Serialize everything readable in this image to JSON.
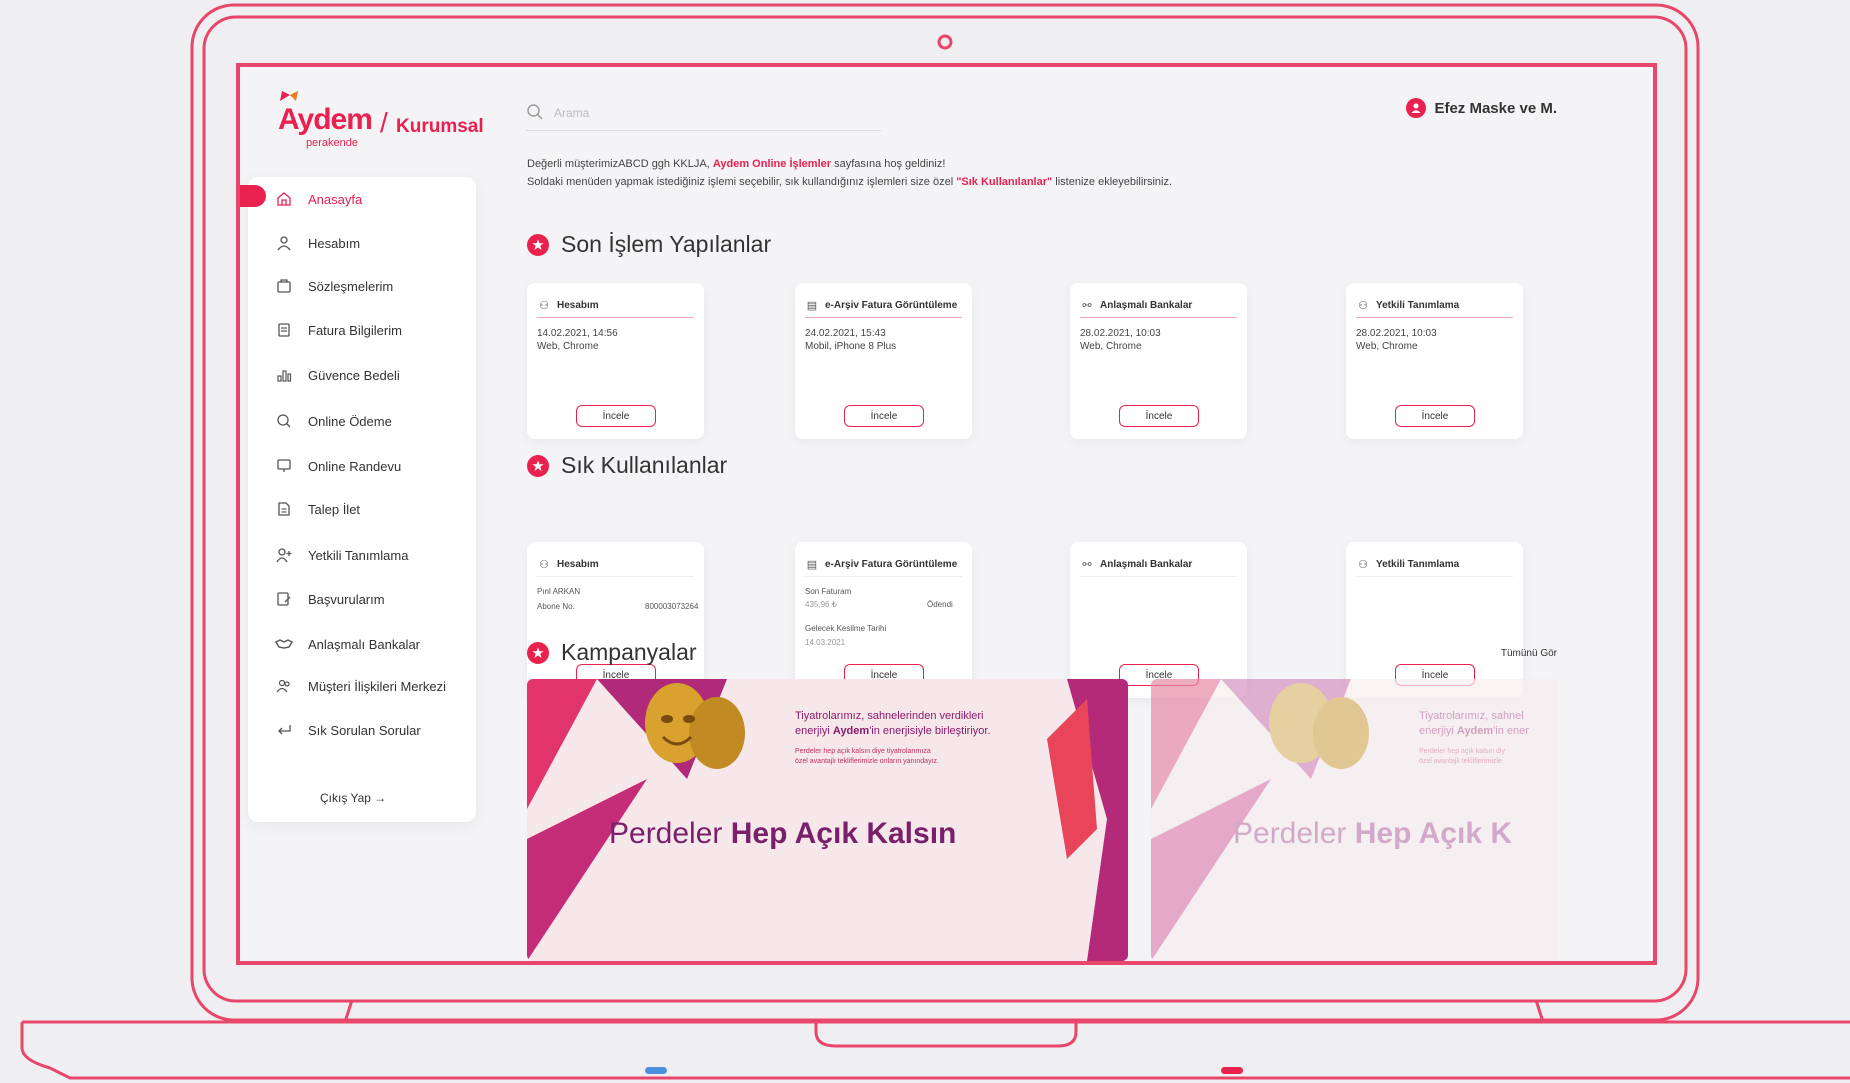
{
  "colors": {
    "accent": "#e8214f",
    "frame": "#e8466a",
    "bg": "#f4f4f7"
  },
  "logo": {
    "brand": "Aydem",
    "sub": "perakende",
    "slash": "/",
    "kurumsal": "Kurumsal"
  },
  "search": {
    "placeholder": "Arama",
    "icon": "search-icon"
  },
  "user": {
    "name": "Efez Maske ve M.",
    "icon": "user-avatar-icon"
  },
  "welcome": {
    "line1_pre": "Değerli müşterimizABCD ggh KKLJA, ",
    "line1_hl": "Aydem Online İşlemler",
    "line1_post": " sayfasına hoş geldiniz!",
    "line2_pre": "Soldaki menüden yapmak istediğiniz işlemi seçebilir, sık kullandığınız işlemleri size özel ",
    "line2_hl": "\"Sık Kullanılanlar\"",
    "line2_post": " listenize ekleyebilirsiniz."
  },
  "sidebar": {
    "items": [
      {
        "label": "Anasayfa",
        "icon": "home-icon"
      },
      {
        "label": "Hesabım",
        "icon": "user-icon"
      },
      {
        "label": "Sözleşmelerim",
        "icon": "contract-icon"
      },
      {
        "label": "Fatura Bilgilerim",
        "icon": "invoice-icon"
      },
      {
        "label": "Güvence Bedeli",
        "icon": "bar-chart-icon"
      },
      {
        "label": "Online Ödeme",
        "icon": "payment-search-icon"
      },
      {
        "label": "Online Randevu",
        "icon": "monitor-icon"
      },
      {
        "label": "Talep İlet",
        "icon": "document-icon"
      },
      {
        "label": "Yetkili Tanımlama",
        "icon": "user-add-icon"
      },
      {
        "label": "Başvurularım",
        "icon": "application-icon"
      },
      {
        "label": "Anlaşmalı Bankalar",
        "icon": "handshake-icon"
      },
      {
        "label": "Müşteri İlişkileri Merkezi",
        "icon": "users-icon"
      },
      {
        "label": "Sık Sorulan Sorular",
        "icon": "return-icon"
      }
    ],
    "logout": "Çıkış Yap →"
  },
  "recent": {
    "title": "Son İşlem Yapılanlar",
    "cards": [
      {
        "title": "Hesabım",
        "icon": "user-icon",
        "date": "14.02.2021, 14:56",
        "device": "Web, Chrome",
        "button": "İncele"
      },
      {
        "title": "e-Arşiv Fatura Görüntüleme",
        "icon": "invoice-icon",
        "date": "24.02.2021, 15:43",
        "device": "Mobil, iPhone 8 Plus",
        "button": "İncele"
      },
      {
        "title": "Anlaşmalı Bankalar",
        "icon": "handshake-icon",
        "date": "28.02.2021, 10:03",
        "device": "Web, Chrome",
        "button": "İncele"
      },
      {
        "title": "Yetkili Tanımlama",
        "icon": "user-add-icon",
        "date": "28.02.2021, 10:03",
        "device": "Web, Chrome",
        "button": "İncele"
      }
    ]
  },
  "favorites": {
    "title": "Sık Kullanılanlar",
    "cards": [
      {
        "title": "Hesabım",
        "icon": "user-icon",
        "name": "Pınl ARKAN",
        "subscriber_label": "Abone No.",
        "subscriber_no": "800003073264",
        "button": "İncele"
      },
      {
        "title": "e-Arşiv Fatura Görüntüleme",
        "icon": "invoice-icon",
        "last_invoice_label": "Son Faturam",
        "last_invoice_amount": "435,96 ₺",
        "status": "Ödendi",
        "next_cut_label": "Gelecek Kesilme Tarihi",
        "next_cut_date": "14.03.2021",
        "button": "İncele"
      },
      {
        "title": "Anlaşmalı Bankalar",
        "icon": "handshake-icon",
        "button": "İncele"
      },
      {
        "title": "Yetkili Tanımlama",
        "icon": "user-add-icon",
        "button": "İncele"
      }
    ]
  },
  "campaigns": {
    "title": "Kampanyalar",
    "see_all": "Tümünü Gör",
    "banners": [
      {
        "line1": "Tiyatrolarımız, sahnelerinden verdikleri",
        "line2_pre": "enerjiyi ",
        "line2_hl": "Aydem",
        "line2_post": "'in enerjisiyle birleştiriyor.",
        "small1": "Perdeler hep açık kalsın diye tiyatrolarımıza",
        "small2": "özel avantajlı tekliflerimizle onların yanındayız.",
        "big_light": "Perdeler ",
        "big_bold": "Hep Açık Kalsın"
      },
      {
        "line1": "Tiyatrolarımız, sahnel",
        "line2_pre": "enerjiyi ",
        "line2_hl": "Aydem",
        "line2_post": "'in ener",
        "small1": "Perdeler hep açık kalsın diy",
        "small2": "özel avantajlı tekliflerimizle",
        "big_light": "Perdeler ",
        "big_bold": "Hep Açık K"
      }
    ]
  }
}
